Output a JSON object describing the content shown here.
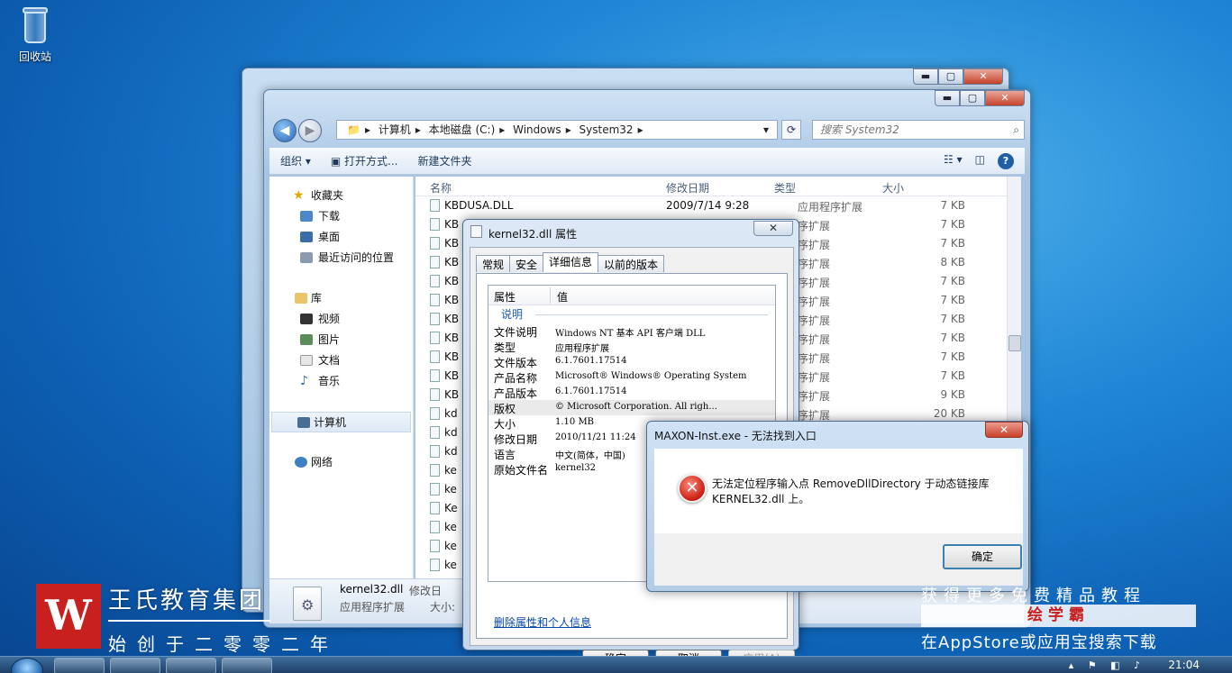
{
  "desktop": {
    "recycle_bin_label": "回收站"
  },
  "explorer": {
    "back_button": "◀",
    "forward_button": "▶",
    "caption_min": "▬",
    "caption_max": "▢",
    "caption_close": "✕",
    "breadcrumb": [
      "计算机",
      "本地磁盘 (C:)",
      "Windows",
      "System32"
    ],
    "search_placeholder": "搜索 System32",
    "commands": {
      "organize": "组织 ▾",
      "open_with": "打开方式...",
      "new_folder": "新建文件夹"
    },
    "nav": {
      "favorites": "收藏夹",
      "downloads": "下载",
      "desktop": "桌面",
      "recent": "最近访问的位置",
      "libraries": "库",
      "videos": "视频",
      "pictures": "图片",
      "documents": "文档",
      "music": "音乐",
      "computer": "计算机",
      "network": "网络"
    },
    "columns": {
      "name": "名称",
      "date": "修改日期",
      "type": "类型",
      "size": "大小"
    },
    "rows": [
      {
        "name": "KBDUSA.DLL",
        "date": "2009/7/14 9:28",
        "type": "应用程序扩展",
        "size": "7 KB"
      },
      {
        "name": "KB",
        "date": "",
        "type": "序扩展",
        "size": "7 KB"
      },
      {
        "name": "KB",
        "date": "",
        "type": "序扩展",
        "size": "7 KB"
      },
      {
        "name": "KB",
        "date": "",
        "type": "序扩展",
        "size": "8 KB"
      },
      {
        "name": "KB",
        "date": "",
        "type": "序扩展",
        "size": "7 KB"
      },
      {
        "name": "KB",
        "date": "",
        "type": "序扩展",
        "size": "7 KB"
      },
      {
        "name": "KB",
        "date": "",
        "type": "序扩展",
        "size": "7 KB"
      },
      {
        "name": "KB",
        "date": "",
        "type": "序扩展",
        "size": "7 KB"
      },
      {
        "name": "KB",
        "date": "",
        "type": "序扩展",
        "size": "7 KB"
      },
      {
        "name": "KB",
        "date": "",
        "type": "序扩展",
        "size": "7 KB"
      },
      {
        "name": "KB",
        "date": "",
        "type": "序扩展",
        "size": "9 KB"
      },
      {
        "name": "kd",
        "date": "",
        "type": "序扩展",
        "size": "20 KB"
      },
      {
        "name": "kd",
        "date": "",
        "type": "",
        "size": ""
      },
      {
        "name": "kd",
        "date": "",
        "type": "",
        "size": ""
      },
      {
        "name": "ke",
        "date": "",
        "type": "",
        "size": ""
      },
      {
        "name": "ke",
        "date": "",
        "type": "",
        "size": ""
      },
      {
        "name": "Ke",
        "date": "",
        "type": "",
        "size": ""
      },
      {
        "name": "ke",
        "date": "",
        "type": "",
        "size": ""
      },
      {
        "name": "ke",
        "date": "",
        "type": "",
        "size": ""
      },
      {
        "name": "ke",
        "date": "",
        "type": "",
        "size": ""
      }
    ],
    "details": {
      "filename": "kernel32.dll",
      "type": "应用程序扩展",
      "date_label": "修改日",
      "size_label": "大小:"
    }
  },
  "properties": {
    "title": "kernel32.dll 属性",
    "close": "✕",
    "tabs": [
      "常规",
      "安全",
      "详细信息",
      "以前的版本"
    ],
    "header_property": "属性",
    "header_value": "值",
    "group": "说明",
    "rows": [
      {
        "k": "文件说明",
        "v": "Windows NT 基本 API 客户端 DLL"
      },
      {
        "k": "类型",
        "v": "应用程序扩展"
      },
      {
        "k": "文件版本",
        "v": "6.1.7601.17514"
      },
      {
        "k": "产品名称",
        "v": "Microsoft® Windows® Operating System"
      },
      {
        "k": "产品版本",
        "v": "6.1.7601.17514"
      },
      {
        "k": "版权",
        "v": "© Microsoft Corporation. All righ..."
      },
      {
        "k": "大小",
        "v": "1.10 MB"
      },
      {
        "k": "修改日期",
        "v": "2010/11/21 11:24"
      },
      {
        "k": "语言",
        "v": "中文(简体，中国)"
      },
      {
        "k": "原始文件名",
        "v": "kernel32"
      }
    ],
    "remove_link": "删除属性和个人信息",
    "ok": "确定",
    "cancel": "取消",
    "apply": "应用(A)"
  },
  "error_dialog": {
    "title": "MAXON-Inst.exe - 无法找到入口",
    "close": "✕",
    "error_glyph": "✕",
    "message": "无法定位程序输入点 RemoveDllDirectory 于动态链接库 KERNEL32.dll 上。",
    "ok": "确定"
  },
  "watermark": {
    "logo_letter": "W",
    "name": "王氏教育集团",
    "subtitle": "始创于二零零二年",
    "promo_line1": "获得更多免费精品教程",
    "promo_line2": "绘学霸",
    "promo_line3": "在AppStore或应用宝搜索下载"
  },
  "taskbar": {
    "clock": "21:04"
  }
}
